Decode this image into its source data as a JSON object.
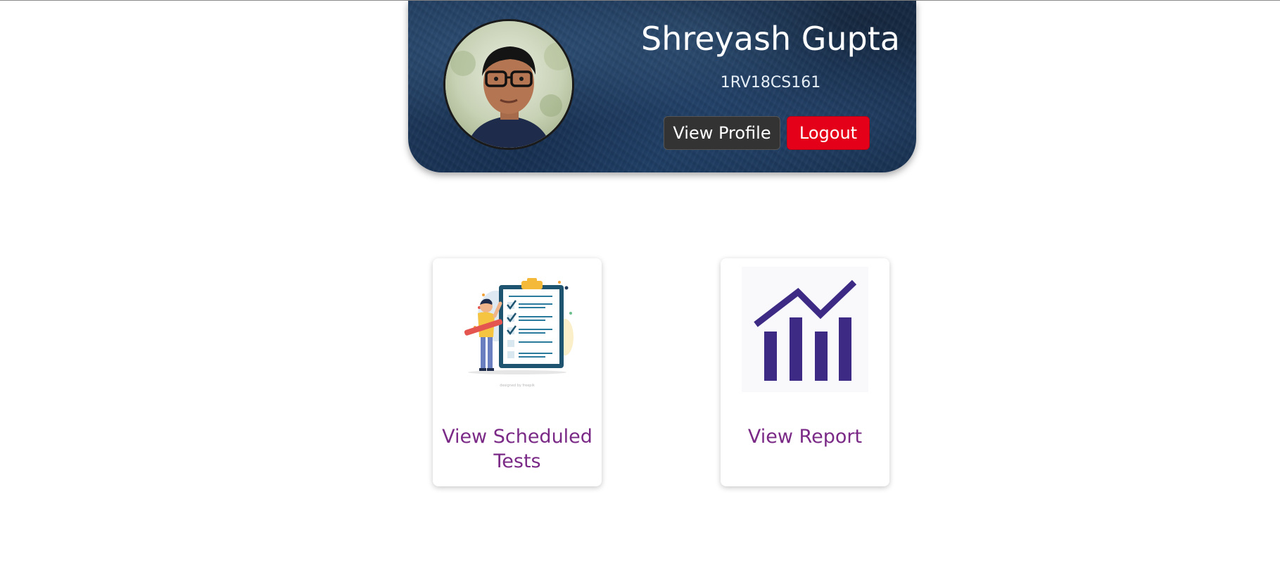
{
  "profile": {
    "name": "Shreyash Gupta",
    "usn": "1RV18CS161",
    "view_profile_label": "View Profile",
    "logout_label": "Logout"
  },
  "cards": [
    {
      "label": "View Scheduled Tests",
      "icon": "checklist-illustration-icon"
    },
    {
      "label": "View Report",
      "icon": "bar-chart-trend-icon"
    }
  ],
  "colors": {
    "header_bg": "#1a3556",
    "logout": "#e5001a",
    "view_profile": "#333333",
    "card_label": "#7a2a86",
    "chart_icon": "#3d2a85"
  }
}
